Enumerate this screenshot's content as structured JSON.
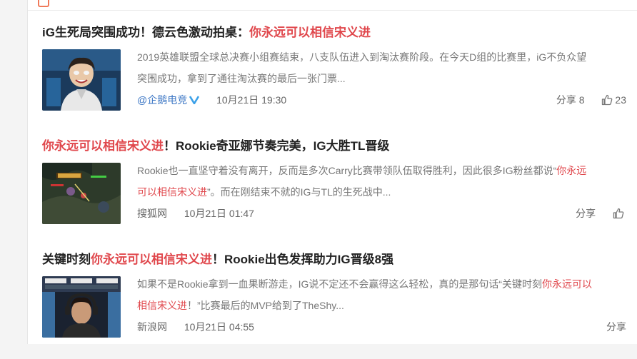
{
  "accent_color": "#e0474c",
  "source_link_color": "#3a75c4",
  "articles": [
    {
      "title_plain": "iG生死局突围成功！德云色激动拍桌：",
      "title_hl": "你永远可以相信宋义进",
      "summary_line1": "2019英雄联盟全球总决赛小组赛结束，八支队伍进入到淘汰赛阶段。在今天D组的比赛里，iG不负众望",
      "summary_line2": "突围成功，拿到了通往淘汰赛的最后一张门票...",
      "source": "@企鹅电竞",
      "verified_icon": "verified-v-icon",
      "time": "10月21日 19:30",
      "share_label": "分享",
      "share_count": "8",
      "like_count": "23"
    },
    {
      "title_hl": "你永远可以相信宋义进",
      "title_plain": "！Rookie奇亚娜节奏完美，IG大胜TL晋级",
      "summary_plain1": "Rookie也一直坚守着没有离开，反而是多次Carry比赛带领队伍取得胜利，因此很多IG粉丝都说“",
      "summary_hl1": "你永远",
      "summary_hl2": "可以相信宋义进",
      "summary_plain2": "”。而在刚结束不就的IG与TL的生死战中...",
      "source": "搜狐网",
      "time": "10月21日 01:47",
      "share_label": "分享"
    },
    {
      "title_plain1": "关键时刻",
      "title_hl": "你永远可以相信宋义进",
      "title_plain2": "！Rookie出色发挥助力IG晋级8强",
      "summary_plain1": "如果不是Rookie拿到一血果断游走，IG说不定还不会赢得这么轻松，真的是那句话“关键时刻",
      "summary_hl1": "你永远可以",
      "summary_hl2": "相信宋义进",
      "summary_plain2": "！”比赛最后的MVP给到了TheShy...",
      "source": "新浪网",
      "time": "10月21日 04:55",
      "share_label": "分享"
    }
  ]
}
